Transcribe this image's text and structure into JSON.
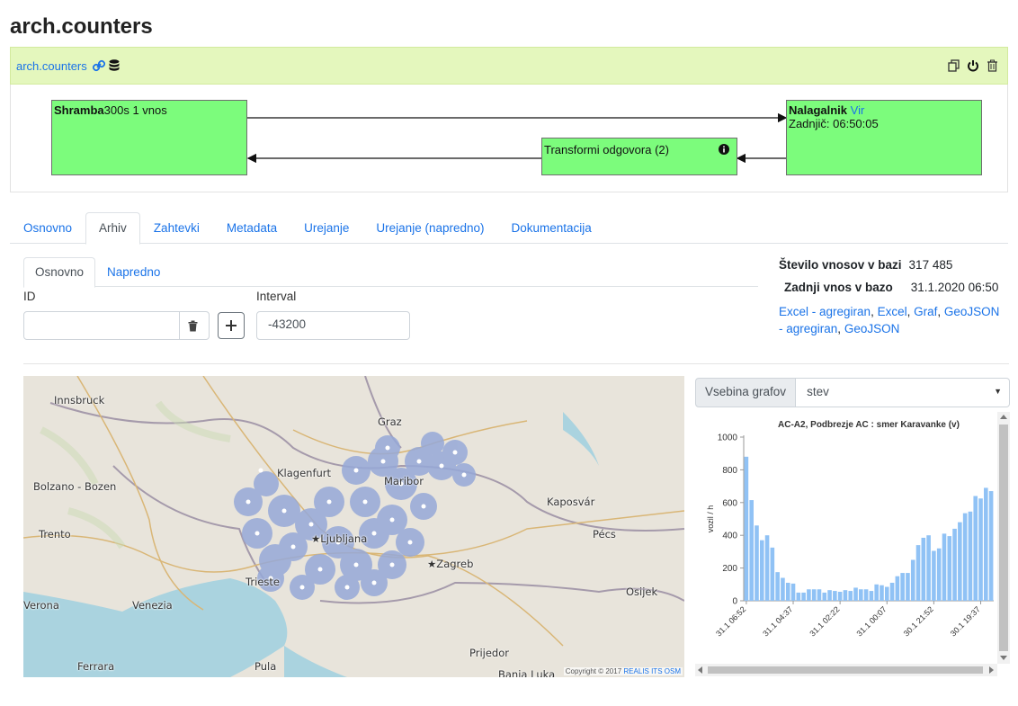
{
  "page": {
    "title": "arch.counters"
  },
  "header": {
    "crumb": "arch.counters"
  },
  "flow": {
    "storage": {
      "title": "Shramba",
      "detail": "300s 1 vnos"
    },
    "loader": {
      "title": "Nalagalnik",
      "link": "Vir",
      "last": "Zadnjič: 06:50:05"
    },
    "transform": {
      "title": "Transformi odgovora (2)"
    }
  },
  "tabs": [
    {
      "label": "Osnovno",
      "active": false
    },
    {
      "label": "Arhiv",
      "active": true
    },
    {
      "label": "Zahtevki",
      "active": false
    },
    {
      "label": "Metadata",
      "active": false
    },
    {
      "label": "Urejanje",
      "active": false
    },
    {
      "label": "Urejanje (napredno)",
      "active": false
    },
    {
      "label": "Dokumentacija",
      "active": false
    }
  ],
  "subtabs": [
    {
      "label": "Osnovno",
      "active": true
    },
    {
      "label": "Napredno",
      "active": false
    }
  ],
  "form": {
    "id_label": "ID",
    "id_value": "",
    "interval_label": "Interval",
    "interval_value": "-43200"
  },
  "stats": {
    "count_label": "Število vnosov v bazi",
    "count_value": "317 485",
    "last_label": "Zadnji vnos v bazo",
    "last_value": "31.1.2020 06:50",
    "links": [
      "Excel - agregiran",
      "Excel",
      "Graf",
      "GeoJSON - agregiran",
      "GeoJSON"
    ]
  },
  "map": {
    "places": [
      "Innsbruck",
      "Graz",
      "Klagenfurt",
      "Maribor",
      "Bolzano - Bozen",
      "Kaposvár",
      "Trento",
      "Pécs",
      "★Ljubljana",
      "★Zagreb",
      "Trieste",
      "Osijek",
      "Verona",
      "Venezia",
      "Prijedor",
      "Ferrara",
      "Pula",
      "Banja Luka"
    ],
    "copyright_prefix": "Copyright © 2017",
    "copyright_links": [
      "REALIS",
      "ITS",
      "OSM"
    ]
  },
  "chart_controls": {
    "addon_label": "Vsebina grafov",
    "selected": "stev"
  },
  "chart_data": {
    "type": "bar",
    "title": "AC-A2, Podbrezje AC : smer Karavanke (v)",
    "ylabel": "vozil / h",
    "xlabel": "",
    "ylim": [
      0,
      1000
    ],
    "yticks": [
      0,
      200,
      400,
      600,
      800,
      1000
    ],
    "xtick_labels": [
      "31.1 06:52",
      "31.1 04:37",
      "31.1 02:22",
      "31.1 00:07",
      "30.1 21:52",
      "30.1 19:37"
    ],
    "color": "#90c2f5",
    "values": [
      880,
      615,
      460,
      370,
      400,
      325,
      175,
      140,
      110,
      105,
      50,
      50,
      70,
      70,
      70,
      50,
      65,
      60,
      55,
      65,
      60,
      80,
      70,
      70,
      60,
      100,
      95,
      85,
      110,
      150,
      170,
      170,
      250,
      340,
      385,
      400,
      305,
      320,
      410,
      395,
      440,
      480,
      535,
      545,
      640,
      625,
      690,
      670
    ]
  }
}
